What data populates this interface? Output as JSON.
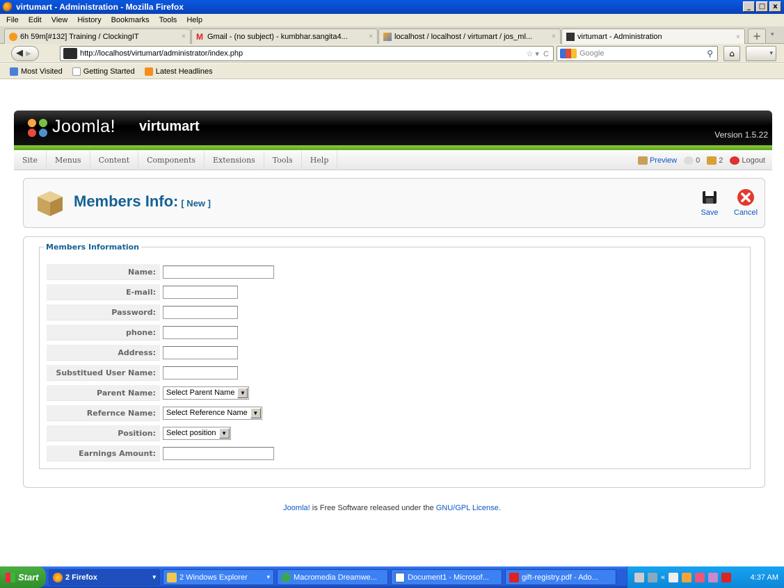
{
  "window": {
    "title": "virtumart - Administration - Mozilla Firefox",
    "controls": [
      "_",
      "□",
      "x"
    ]
  },
  "menubar": [
    "File",
    "Edit",
    "View",
    "History",
    "Bookmarks",
    "Tools",
    "Help"
  ],
  "tabs": [
    {
      "label": "6h 59m[#132] Training / ClockingIT"
    },
    {
      "label": "Gmail - (no subject) - kumbhar.sangita4..."
    },
    {
      "label": "localhost / localhost / virtumart / jos_ml..."
    },
    {
      "label": "virtumart - Administration"
    }
  ],
  "address": {
    "url": "http://localhost/virtumart/administrator/index.php",
    "search_placeholder": "Google"
  },
  "bookmarks": [
    "Most Visited",
    "Getting Started",
    "Latest Headlines"
  ],
  "joomla": {
    "logo_text": "Joomla!",
    "site_name": "virtumart",
    "version": "Version 1.5.22",
    "menu": [
      "Site",
      "Menus",
      "Content",
      "Components",
      "Extensions",
      "Tools",
      "Help"
    ],
    "status": {
      "preview": "Preview",
      "messages": "0",
      "users": "2",
      "logout": "Logout"
    }
  },
  "page": {
    "title": "Members Info:",
    "subtitle": "[ New ]",
    "save": "Save",
    "cancel": "Cancel"
  },
  "form": {
    "legend": "Members Information",
    "fields": [
      {
        "label": "Name:",
        "type": "text"
      },
      {
        "label": "E-mail:",
        "type": "text"
      },
      {
        "label": "Password:",
        "type": "text"
      },
      {
        "label": "phone:",
        "type": "text"
      },
      {
        "label": "Address:",
        "type": "text"
      },
      {
        "label": "Substitued User Name:",
        "type": "text"
      },
      {
        "label": "Parent Name:",
        "type": "select",
        "value": "Select Parent Name"
      },
      {
        "label": "Refernce Name:",
        "type": "select",
        "value": "Select Reference Name"
      },
      {
        "label": "Position:",
        "type": "select",
        "value": "Select position"
      },
      {
        "label": "Earnings Amount:",
        "type": "text"
      }
    ]
  },
  "footer": {
    "link1": "Joomla!",
    "text": " is Free Software released under the ",
    "link2": "GNU/GPL License",
    "end": "."
  },
  "taskbar": {
    "start": "Start",
    "tasks": [
      "2 Firefox",
      "2 Windows Explorer",
      "Macromedia Dreamwe...",
      "Document1 - Microsof...",
      "gift-registry.pdf - Ado..."
    ],
    "clock": "4:37 AM"
  },
  "colors": {
    "joomla_blue": "#146295",
    "link_blue": "#0b55c4",
    "joomla_green": "#6fb62a",
    "xp_blue": "#245edb"
  }
}
